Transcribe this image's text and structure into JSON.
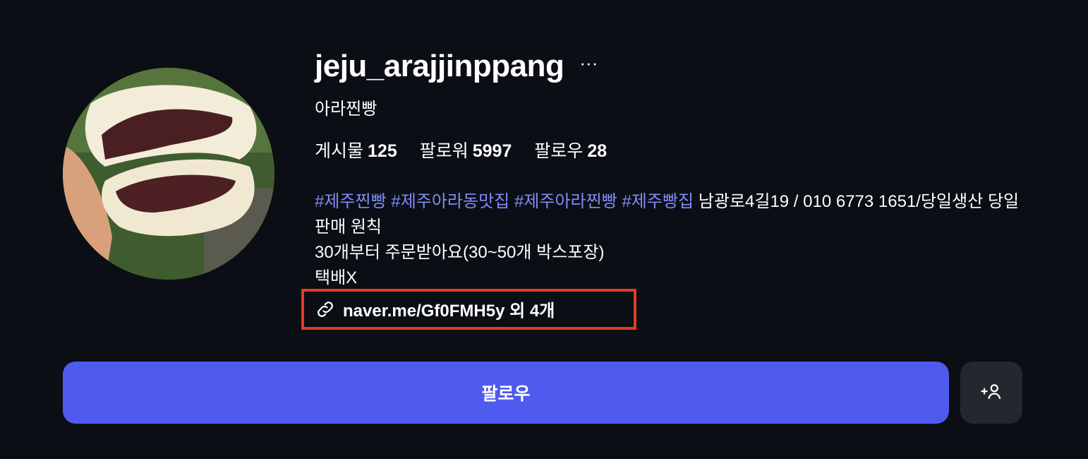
{
  "profile": {
    "username": "jeju_arajjinppang",
    "more_label": "···",
    "full_name": "아라찐빵",
    "avatar_icon": "steamed-bun-photo"
  },
  "stats": [
    {
      "label": "게시물",
      "value": "125"
    },
    {
      "label": "팔로워",
      "value": "5997"
    },
    {
      "label": "팔로우",
      "value": "28"
    }
  ],
  "bio": {
    "hashtags": [
      "#제주찐빵",
      "#제주아라동맛집",
      "#제주아라찐빵",
      "#제주빵집"
    ],
    "line1_text": "남광로4길19 / 010 6773 1651/당일생산 당일판매 원칙",
    "line2": "30개부터 주문받아요(30~50개 박스포장)",
    "line3": "택배X",
    "link_text": "naver.me/Gf0FMH5y 외 4개",
    "link_icon": "link-icon"
  },
  "buttons": {
    "follow_label": "팔로우",
    "suggest_icon": "add-person-icon"
  },
  "colors": {
    "background": "#0b0e14",
    "hashtag": "#7f8cf7",
    "follow_button": "#4f5bef",
    "secondary_button": "#24272d",
    "highlight_border": "#e23b26"
  }
}
